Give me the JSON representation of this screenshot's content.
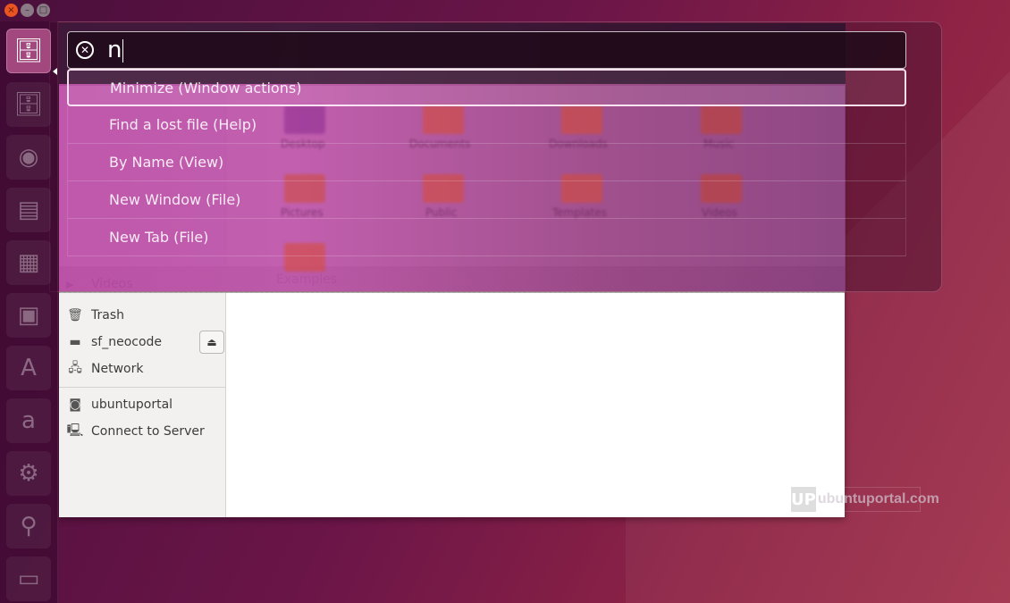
{
  "window_controls": {
    "close_glyph": "×",
    "minimize_glyph": "–",
    "maximize_glyph": "□"
  },
  "launcher": {
    "items": [
      {
        "name": "files",
        "icon": "file-cabinet-icon",
        "glyph": "🗄",
        "active": true
      },
      {
        "name": "files-secondary",
        "icon": "file-cabinet-icon",
        "glyph": "🗄",
        "active": false
      },
      {
        "name": "firefox",
        "icon": "firefox-icon",
        "glyph": "◉",
        "active": false
      },
      {
        "name": "writer",
        "icon": "libreoffice-writer-icon",
        "glyph": "▤",
        "active": false
      },
      {
        "name": "calc",
        "icon": "libreoffice-calc-icon",
        "glyph": "▦",
        "active": false
      },
      {
        "name": "impress",
        "icon": "libreoffice-impress-icon",
        "glyph": "▣",
        "active": false
      },
      {
        "name": "software-center",
        "icon": "software-center-icon",
        "glyph": "A",
        "active": false
      },
      {
        "name": "amazon",
        "icon": "amazon-icon",
        "glyph": "a",
        "active": false
      },
      {
        "name": "system-settings",
        "icon": "settings-gear-icon",
        "glyph": "⚙",
        "active": false
      },
      {
        "name": "drive",
        "icon": "drive-icon",
        "glyph": "⚲",
        "active": false
      },
      {
        "name": "workspace-switcher",
        "icon": "workspace-icon",
        "glyph": "▭",
        "active": false
      }
    ]
  },
  "hud": {
    "search": {
      "query": "n",
      "clear_icon": "⊗"
    },
    "results": [
      {
        "label": "Minimize (Window actions)",
        "selected": true
      },
      {
        "label": "Find a lost file (Help)",
        "selected": false
      },
      {
        "label": "By Name (View)",
        "selected": false
      },
      {
        "label": "New Window (File)",
        "selected": false
      },
      {
        "label": "New Tab (File)",
        "selected": false
      }
    ]
  },
  "file_manager": {
    "sidebar": {
      "items": [
        {
          "label": "Videos",
          "icon": "videos-icon",
          "glyph": "▶"
        },
        {
          "label": "Trash",
          "icon": "trash-icon",
          "glyph": "🗑"
        },
        {
          "label": "sf_neocode",
          "icon": "drive-icon",
          "glyph": "▬"
        },
        {
          "label": "Network",
          "icon": "network-icon",
          "glyph": "🖧"
        },
        {
          "label": "ubuntuportal",
          "icon": "disk-icon",
          "glyph": "◙"
        },
        {
          "label": "Connect to Server",
          "icon": "server-icon",
          "glyph": "🖳"
        }
      ],
      "eject_glyph": "⏏"
    },
    "folders_visible": [
      "Desktop",
      "Documents",
      "Downloads",
      "Music",
      "Pictures",
      "Public",
      "Templates",
      "Videos",
      "Examples"
    ],
    "examples_label": "Examples"
  },
  "watermark": {
    "logo": "UP",
    "text": "ubuntuportal.com"
  }
}
